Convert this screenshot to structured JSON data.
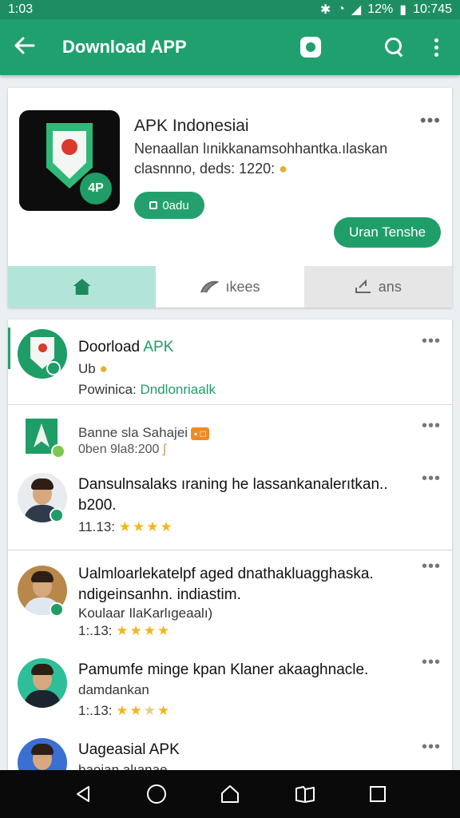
{
  "status_bar": {
    "time": "1:03",
    "battery": "12%",
    "clock": "10:745"
  },
  "app_bar": {
    "title": "Download APP",
    "back_icon": "arrow-left-icon",
    "store_icon": "store-icon",
    "search_icon": "search-icon",
    "more_icon": "more-vert-icon"
  },
  "header_card": {
    "app_name": "APK Indonesiai",
    "description": "Nenaallan lınikkanamsohhantka.ılaskan clasnnno, deds: 1220:",
    "chip_label": "0adu",
    "install_label": "Uran Tenshe",
    "icon_badge": "4P",
    "tabs": [
      {
        "label": "",
        "icon": "home-icon"
      },
      {
        "label": "ıkees",
        "icon": "leaf-icon"
      },
      {
        "label": "ans",
        "icon": "share-icon"
      }
    ]
  },
  "list": {
    "items": [
      {
        "title_prefix": "Doorload ",
        "title_accent": "APK",
        "line2": "Ub",
        "line3_prefix": "Powinica: ",
        "line3_accent": "Dndlonriaalk"
      },
      {
        "title": "Banne sla Sahajei",
        "tag": "",
        "sub": "0ben 9la8:200"
      },
      {
        "title": "Dansulnsalaks ıraning he lassankanalerıtkan..",
        "line2": "b200.",
        "meta": "11.13:",
        "stars": 4
      },
      {
        "title": "Ualmloarlekatelpf aged dnathakluagghaska.",
        "line2": "ndigeinsanhn. indiastim.",
        "line3": "Koulaar IlaKarlıgeaalı)",
        "meta": "1:.13:",
        "stars": 4
      },
      {
        "title": "Pamumfe minge kpan Klaner akaaghnacle.",
        "line2": "damdankan",
        "meta": "1:.13:",
        "stars": 2
      },
      {
        "title": "Uageasial APK",
        "line2": "baoian alıanae"
      }
    ]
  },
  "colors": {
    "primary": "#21a06f",
    "primary_dark": "#1e8e62",
    "accent_star": "#f2b51c",
    "tab_home_bg": "#b2e5d8"
  },
  "nav_bar": {
    "icons": [
      "back-icon",
      "home-circle-icon",
      "home-icon",
      "book-icon",
      "recents-icon"
    ]
  }
}
